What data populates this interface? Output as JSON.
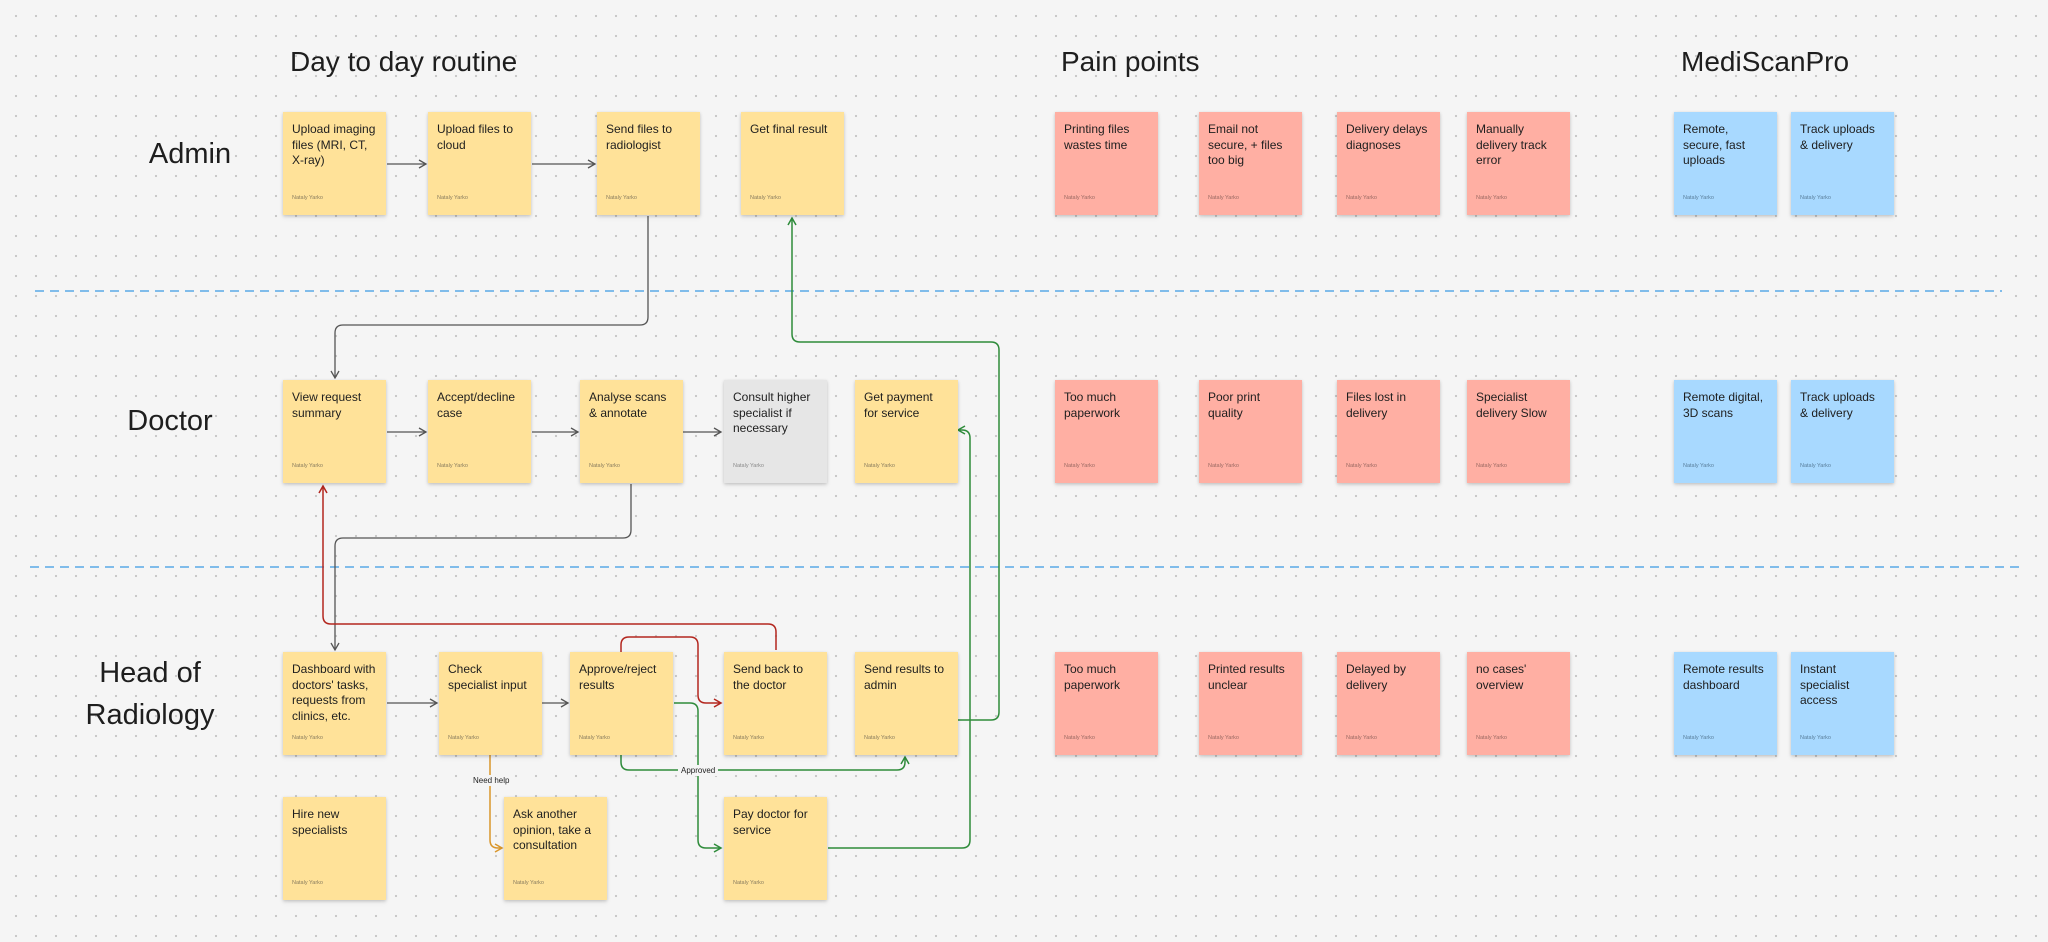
{
  "headings": {
    "routine": "Day to day routine",
    "pain": "Pain points",
    "product": "MediScanPro"
  },
  "roles": {
    "admin": "Admin",
    "doctor": "Doctor",
    "head_line1": "Head of",
    "head_line2": "Radiology"
  },
  "author": "Nataly Yarko",
  "admin": {
    "routine": [
      "Upload imaging files (MRI, CT, X-ray)",
      "Upload files to cloud",
      "Send files to radiologist",
      "Get final result"
    ],
    "pain": [
      "Printing files wastes time",
      "Email not secure, + files too big",
      "Delivery delays diagnoses",
      "Manually delivery track error"
    ],
    "product": [
      "Remote, secure, fast uploads",
      "Track uploads & delivery"
    ]
  },
  "doctor": {
    "routine": [
      "View request summary",
      "Accept/decline case",
      "Analyse scans & annotate",
      "Consult higher specialist if necessary",
      "Get payment for service"
    ],
    "pain": [
      "Too much paperwork",
      "Poor print quality",
      "Files lost in delivery",
      "Specialist delivery Slow"
    ],
    "product": [
      "Remote digital, 3D scans",
      "Track uploads & delivery"
    ]
  },
  "head": {
    "routine": [
      "Dashboard with doctors' tasks, requests from clinics, etc.",
      "Check specialist input",
      "Approve/reject results",
      "Send back to the doctor",
      "Send results to admin"
    ],
    "extra": [
      "Hire new specialists",
      "Ask another opinion, take a consultation",
      "Pay doctor for service"
    ],
    "pain": [
      "Too much paperwork",
      "Printed results unclear",
      "Delayed by delivery",
      "no cases' overview"
    ],
    "product": [
      "Remote results dashboard",
      "Instant specialist access"
    ]
  },
  "connector_labels": {
    "need_help": "Need help",
    "approved": "Approved"
  },
  "colors": {
    "routine": "#ffe299",
    "pain": "#ffafa3",
    "product": "#a8d9ff",
    "optional": "#e6e6e6",
    "connector_default": "#555555",
    "connector_green": "#2e8b3a",
    "connector_red": "#b3261e",
    "connector_orange": "#d9962b",
    "lane_divider": "#5aa9e6"
  }
}
